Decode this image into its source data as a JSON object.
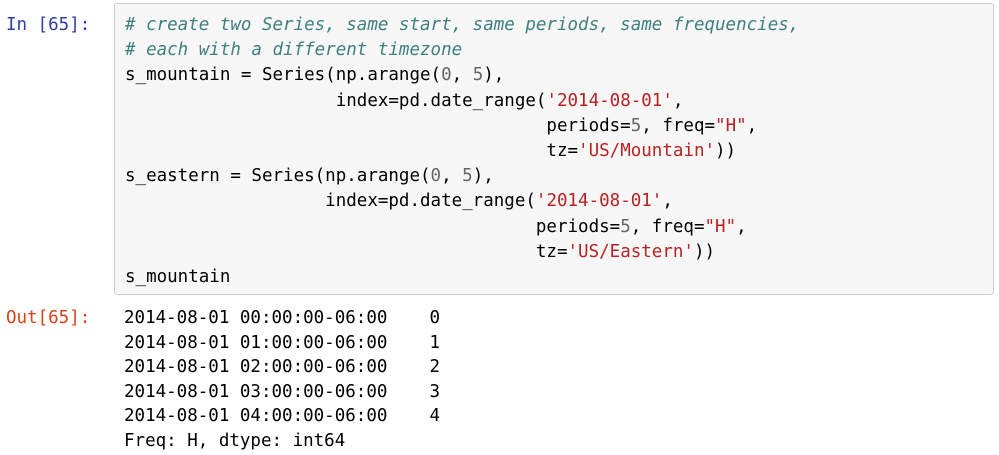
{
  "cell": {
    "in_prompt": "In [65]:",
    "out_prompt": "Out[65]:",
    "code": [
      [
        {
          "t": "comment",
          "v": "# create two Series, same start, same periods, same frequencies,"
        }
      ],
      [
        {
          "t": "comment",
          "v": "# each with a different timezone"
        }
      ],
      [
        {
          "t": "plain",
          "v": "s_mountain = Series(np.arange("
        },
        {
          "t": "number",
          "v": "0"
        },
        {
          "t": "plain",
          "v": ", "
        },
        {
          "t": "number",
          "v": "5"
        },
        {
          "t": "plain",
          "v": "),"
        }
      ],
      [
        {
          "t": "plain",
          "v": "                    index=pd.date_range("
        },
        {
          "t": "string",
          "v": "'2014-08-01'"
        },
        {
          "t": "plain",
          "v": ","
        }
      ],
      [
        {
          "t": "plain",
          "v": "                                        periods="
        },
        {
          "t": "number",
          "v": "5"
        },
        {
          "t": "plain",
          "v": ", freq="
        },
        {
          "t": "string",
          "v": "\"H\""
        },
        {
          "t": "plain",
          "v": ","
        }
      ],
      [
        {
          "t": "plain",
          "v": "                                        tz="
        },
        {
          "t": "string",
          "v": "'US/Mountain'"
        },
        {
          "t": "plain",
          "v": "))"
        }
      ],
      [
        {
          "t": "plain",
          "v": "s_eastern = Series(np.arange("
        },
        {
          "t": "number",
          "v": "0"
        },
        {
          "t": "plain",
          "v": ", "
        },
        {
          "t": "number",
          "v": "5"
        },
        {
          "t": "plain",
          "v": "),"
        }
      ],
      [
        {
          "t": "plain",
          "v": "                   index=pd.date_range("
        },
        {
          "t": "string",
          "v": "'2014-08-01'"
        },
        {
          "t": "plain",
          "v": ","
        }
      ],
      [
        {
          "t": "plain",
          "v": "                                       periods="
        },
        {
          "t": "number",
          "v": "5"
        },
        {
          "t": "plain",
          "v": ", freq="
        },
        {
          "t": "string",
          "v": "\"H\""
        },
        {
          "t": "plain",
          "v": ","
        }
      ],
      [
        {
          "t": "plain",
          "v": "                                       tz="
        },
        {
          "t": "string",
          "v": "'US/Eastern'"
        },
        {
          "t": "plain",
          "v": "))"
        }
      ],
      [
        {
          "t": "plain",
          "v": "s_mountain"
        }
      ]
    ],
    "output_lines": [
      "2014-08-01 00:00:00-06:00    0",
      "2014-08-01 01:00:00-06:00    1",
      "2014-08-01 02:00:00-06:00    2",
      "2014-08-01 03:00:00-06:00    3",
      "2014-08-01 04:00:00-06:00    4",
      "Freq: H, dtype: int64"
    ]
  },
  "colors": {
    "in_prompt": "#303f9f",
    "out_prompt": "#d84315",
    "comment": "#408080",
    "string": "#ba2121",
    "number": "#666666",
    "input_bg": "#f7f7f7",
    "input_border": "#cfcfcf"
  }
}
